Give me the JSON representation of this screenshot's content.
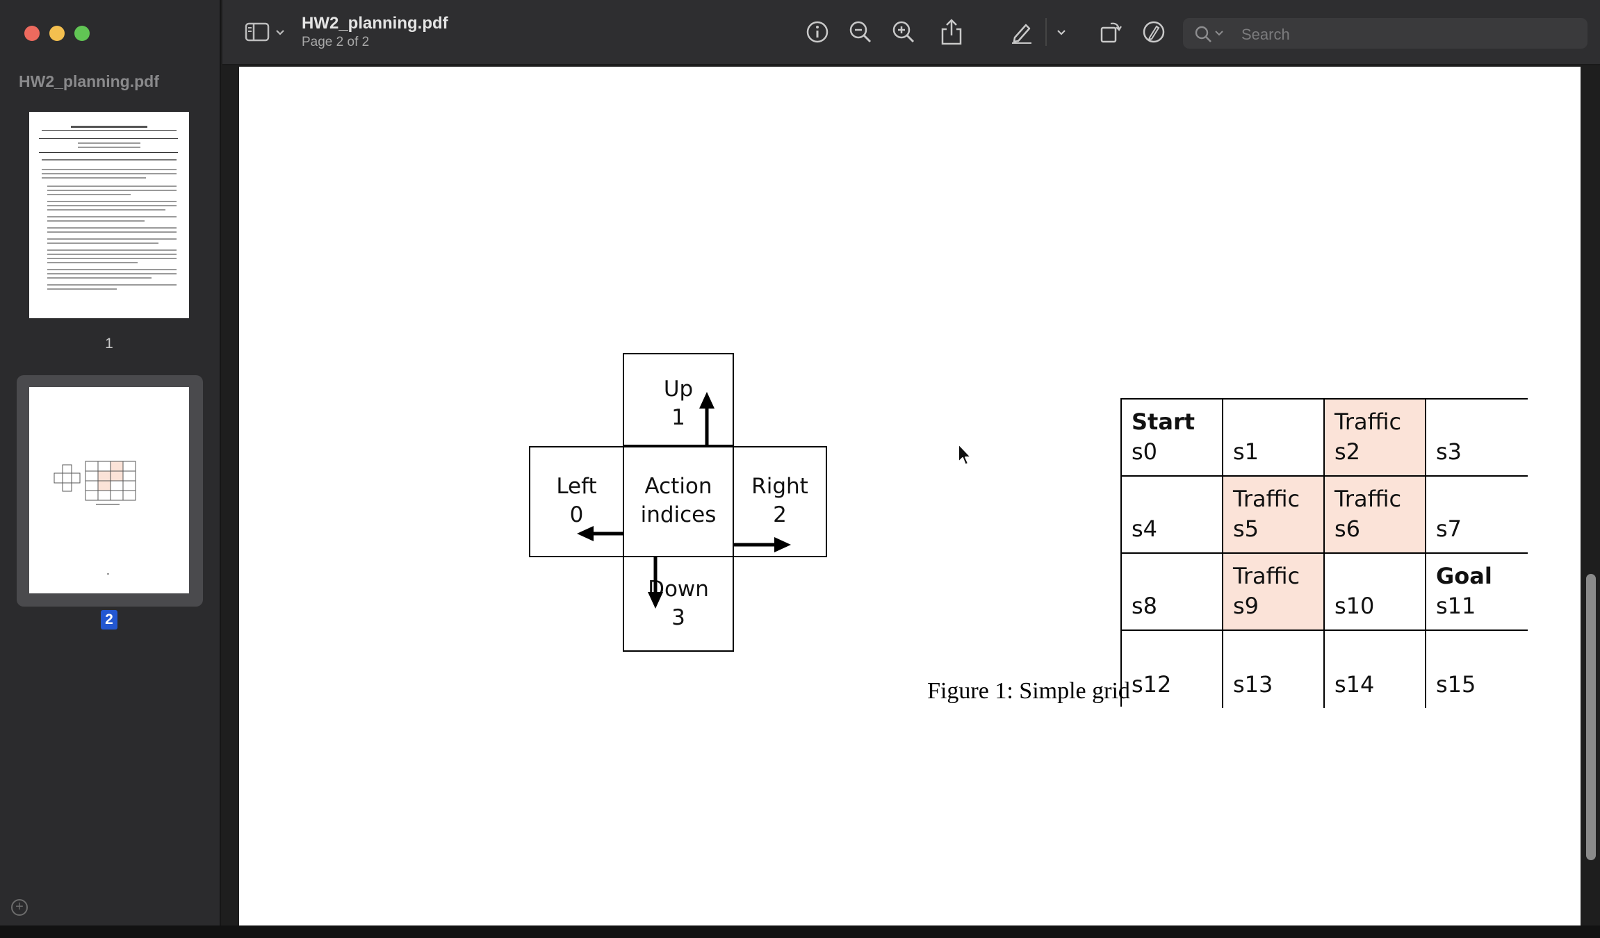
{
  "window": {
    "title": "HW2_planning.pdf",
    "subtitle": "Page 2 of 2"
  },
  "sidebar": {
    "doc_label": "HW2_planning.pdf",
    "pages": [
      {
        "number": "1"
      },
      {
        "number": "2",
        "selected": true
      }
    ]
  },
  "toolbar": {
    "search_placeholder": "Search",
    "icons": [
      "sidebar-toggle-icon",
      "chevron-down-icon",
      "info-icon",
      "zoom-out-icon",
      "zoom-in-icon",
      "share-icon",
      "markup-pen-icon",
      "chevron-down-icon",
      "rotate-icon",
      "annotate-icon",
      "search-icon"
    ]
  },
  "figure": {
    "actions": {
      "center": [
        "Action",
        "indices"
      ],
      "up": {
        "label": "Up",
        "index": "1"
      },
      "left": {
        "label": "Left",
        "index": "0"
      },
      "right": {
        "label": "Right",
        "index": "2"
      },
      "down": {
        "label": "Down",
        "index": "3"
      }
    },
    "grid": [
      {
        "title": "Start",
        "title_bold": true,
        "id": "s0",
        "traffic": false
      },
      {
        "title": "",
        "id": "s1",
        "traffic": false
      },
      {
        "title": "Traffic",
        "id": "s2",
        "traffic": true
      },
      {
        "title": "",
        "id": "s3",
        "traffic": false
      },
      {
        "title": "",
        "id": "s4",
        "traffic": false
      },
      {
        "title": "Traffic",
        "id": "s5",
        "traffic": true
      },
      {
        "title": "Traffic",
        "id": "s6",
        "traffic": true
      },
      {
        "title": "",
        "id": "s7",
        "traffic": false
      },
      {
        "title": "",
        "id": "s8",
        "traffic": false
      },
      {
        "title": "Traffic",
        "id": "s9",
        "traffic": true
      },
      {
        "title": "",
        "id": "s10",
        "traffic": false
      },
      {
        "title": "Goal",
        "title_bold": true,
        "id": "s11",
        "traffic": false
      },
      {
        "title": "",
        "id": "s12",
        "traffic": false
      },
      {
        "title": "",
        "id": "s13",
        "traffic": false
      },
      {
        "title": "",
        "id": "s14",
        "traffic": false
      },
      {
        "title": "",
        "id": "s15",
        "traffic": false
      }
    ],
    "caption": "Figure 1: Simple grid"
  },
  "colors": {
    "traffic": "#fbe3d8",
    "selected_page": "#2357d1"
  }
}
